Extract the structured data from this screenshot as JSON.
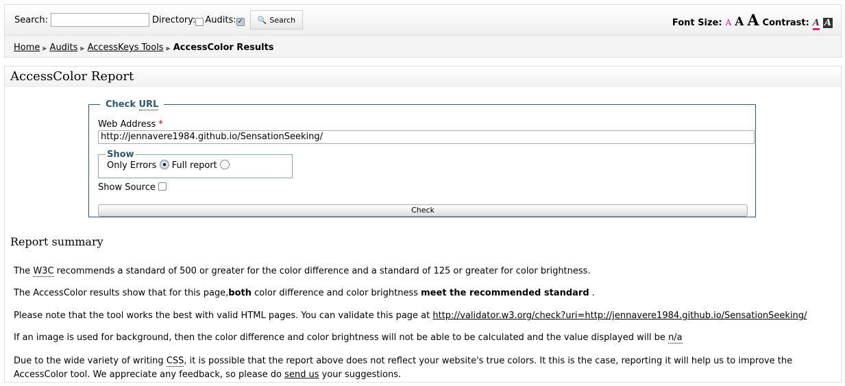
{
  "toolbar": {
    "search_label": "Search:",
    "directory_label": "Directory:",
    "audits_label": "Audits:",
    "search_button": "Search",
    "font_size_label": "Font Size:",
    "font_a": "A",
    "contrast_label": "Contrast:"
  },
  "breadcrumb": [
    "Home",
    "Audits",
    "AccessKeys Tools",
    "AccessColor Results"
  ],
  "report": {
    "title": "AccessColor Report",
    "legend_prefix": "Check",
    "legend_abbr": "URL",
    "web_address_label": "Web Address",
    "required": "*",
    "url_value": "http://jennavere1984.github.io/SensationSeeking/",
    "show_legend": "Show",
    "only_errors": "Only Errors",
    "full_report": "Full report",
    "show_source": "Show Source",
    "check_button": "Check"
  },
  "summary": {
    "title": "Report summary",
    "p1a": "The",
    "p1abbr": "W3C",
    "p1b": "recommends a standard of 500 or greater for the color difference and a standard of 125 or greater for color brightness.",
    "p2a": "The AccessColor results show that for this page,",
    "p2b": "both",
    "p2c": " color difference and color brightness ",
    "p2d": "meet the recommended standard",
    "p2e": " .",
    "p3a": "Please note that the tool works the best with valid HTML pages. You can validate this page at ",
    "p3link": "http://validator.w3.org/check?uri=http://jennavere1984.github.io/SensationSeeking/",
    "p4a": "If an image is used for background, then the color difference and color brightness will not be able to be calculated and the value displayed will be ",
    "p4abbr": "n/a",
    "p5a": "Due to the wide variety of writing ",
    "p5abbr": "CSS",
    "p5b": ", it is possible that the report above does not reflect your website's true colors. It this is the case, reporting it will help us to improve the AccessColor tool. We appreciate any feedback, so please do ",
    "p5link": "send us",
    "p5c": " your suggestions."
  }
}
